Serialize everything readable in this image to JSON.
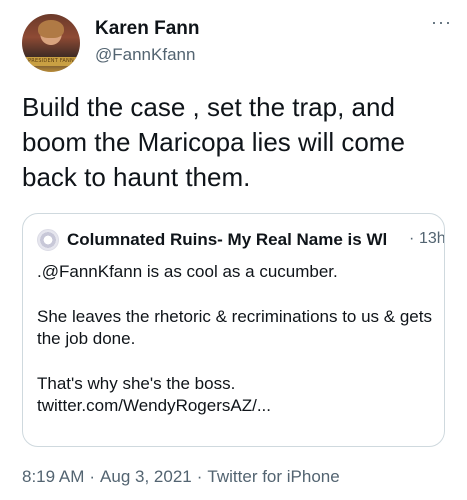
{
  "author": {
    "name": "Karen Fann",
    "handle": "@FannKfann",
    "avatar_caption": "PRESIDENT FANN"
  },
  "more_label": "···",
  "tweet": {
    "text": "Build the case , set the trap, and boom the Maricopa lies will come back to haunt them."
  },
  "quoted_tweet": {
    "author_name": "Columnated Ruins- My Real Name is Wl",
    "separator": "·",
    "time": "13h",
    "lines": [
      ".@FannKfann is as cool as a cucumber.",
      "She leaves the rhetoric & recriminations to us & gets the job done.",
      "That's why she's the boss.",
      "twitter.com/WendyRogersAZ/..."
    ]
  },
  "meta": {
    "time": "8:19 AM",
    "date": "Aug 3, 2021",
    "source": "Twitter for iPhone",
    "separator": "·"
  }
}
